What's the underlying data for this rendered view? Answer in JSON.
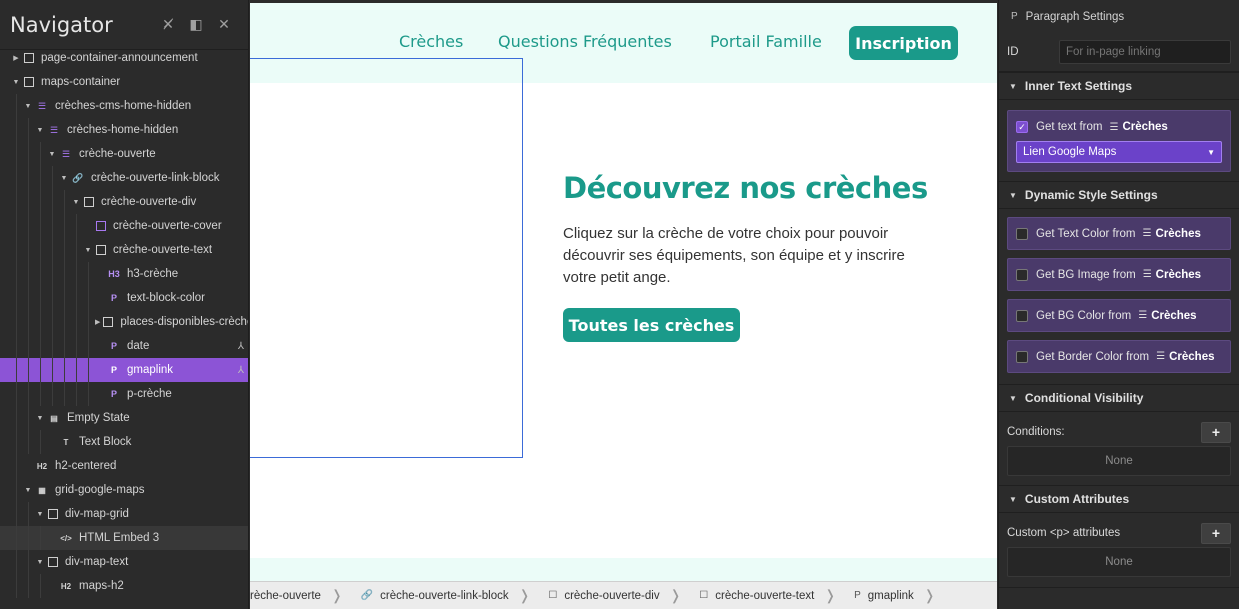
{
  "navigator": {
    "title": "Navigator",
    "tree": [
      {
        "label": "page-container-announcement",
        "depth": 0,
        "expand": "closed",
        "icon": "box",
        "glyph": ""
      },
      {
        "label": "maps-container",
        "depth": 0,
        "expand": "open",
        "icon": "box",
        "glyph": ""
      },
      {
        "label": "crèches-cms-home-hidden",
        "depth": 1,
        "expand": "open",
        "icon": "purple",
        "glyph": "☰"
      },
      {
        "label": "crèches-home-hidden",
        "depth": 2,
        "expand": "open",
        "icon": "purple",
        "glyph": "☰"
      },
      {
        "label": "crèche-ouverte",
        "depth": 3,
        "expand": "open",
        "icon": "purple",
        "glyph": "☰"
      },
      {
        "label": "crèche-ouverte-link-block",
        "depth": 4,
        "expand": "open",
        "icon": "purple",
        "glyph": "🔗"
      },
      {
        "label": "crèche-ouverte-div",
        "depth": 5,
        "expand": "open",
        "icon": "box",
        "glyph": ""
      },
      {
        "label": "crèche-ouverte-cover",
        "depth": 6,
        "expand": "none",
        "icon": "pbox",
        "glyph": ""
      },
      {
        "label": "crèche-ouverte-text",
        "depth": 6,
        "expand": "open",
        "icon": "box",
        "glyph": ""
      },
      {
        "label": "h3-crèche",
        "depth": 7,
        "expand": "none",
        "icon": "p",
        "glyph": "H3"
      },
      {
        "label": "text-block-color",
        "depth": 7,
        "expand": "none",
        "icon": "p",
        "glyph": "P"
      },
      {
        "label": "places-disponibles-crèche",
        "depth": 7,
        "expand": "closed",
        "icon": "box",
        "glyph": ""
      },
      {
        "label": "date",
        "depth": 7,
        "expand": "none",
        "icon": "p",
        "glyph": "P",
        "pin": true
      },
      {
        "label": "gmaplink",
        "depth": 7,
        "expand": "none",
        "icon": "p",
        "glyph": "P",
        "pin": true,
        "selected": true
      },
      {
        "label": "p-crèche",
        "depth": 7,
        "expand": "none",
        "icon": "p",
        "glyph": "P"
      },
      {
        "label": "Empty State",
        "depth": 2,
        "expand": "open",
        "icon": "h",
        "glyph": "▤"
      },
      {
        "label": "Text Block",
        "depth": 3,
        "expand": "none",
        "icon": "h",
        "glyph": "T"
      },
      {
        "label": "h2-centered",
        "depth": 1,
        "expand": "none",
        "icon": "h",
        "glyph": "H2"
      },
      {
        "label": "grid-google-maps",
        "depth": 1,
        "expand": "open",
        "icon": "h",
        "glyph": "▦"
      },
      {
        "label": "div-map-grid",
        "depth": 2,
        "expand": "open",
        "icon": "box",
        "glyph": ""
      },
      {
        "label": "HTML Embed 3",
        "depth": 3,
        "expand": "none",
        "icon": "h",
        "glyph": "</>",
        "hover": true
      },
      {
        "label": "div-map-text",
        "depth": 2,
        "expand": "open",
        "icon": "box",
        "glyph": ""
      },
      {
        "label": "maps-h2",
        "depth": 3,
        "expand": "none",
        "icon": "h",
        "glyph": "H2"
      }
    ]
  },
  "site": {
    "nav_links": [
      "Crèches",
      "Questions Fréquentes",
      "Portail Famille"
    ],
    "nav_cta": "Inscription",
    "heading": "Découvrez nos crèches",
    "paragraph": "Cliquez sur la crèche de votre choix pour pouvoir découvrir ses équipements, son équipe et y inscrire votre petit ange.",
    "cta": "Toutes les crèches"
  },
  "breadcrumbs": [
    {
      "label": "rèche-ouverte",
      "icon": ""
    },
    {
      "label": "crèche-ouverte-link-block",
      "icon": "🔗"
    },
    {
      "label": "crèche-ouverte-div",
      "icon": "☐"
    },
    {
      "label": "crèche-ouverte-text",
      "icon": "☐"
    },
    {
      "label": "gmaplink",
      "icon": "P"
    }
  ],
  "panel": {
    "title": "Paragraph Settings",
    "id_label": "ID",
    "id_placeholder": "For in-page linking",
    "inner_text": {
      "heading": "Inner Text Settings",
      "get_text_label": "Get text from",
      "collection": "Crèches",
      "field": "Lien Google Maps",
      "checked": true
    },
    "dynamic_style": {
      "heading": "Dynamic Style Settings",
      "items": [
        {
          "label": "Get Text Color from",
          "collection": "Crèches"
        },
        {
          "label": "Get BG Image from",
          "collection": "Crèches"
        },
        {
          "label": "Get BG Color from",
          "collection": "Crèches"
        },
        {
          "label": "Get Border Color from",
          "collection": "Crèches"
        }
      ]
    },
    "conditional": {
      "heading": "Conditional Visibility",
      "conditions_label": "Conditions:",
      "none": "None"
    },
    "custom_attrs": {
      "heading": "Custom Attributes",
      "label": "Custom <p> attributes",
      "none": "None"
    }
  }
}
